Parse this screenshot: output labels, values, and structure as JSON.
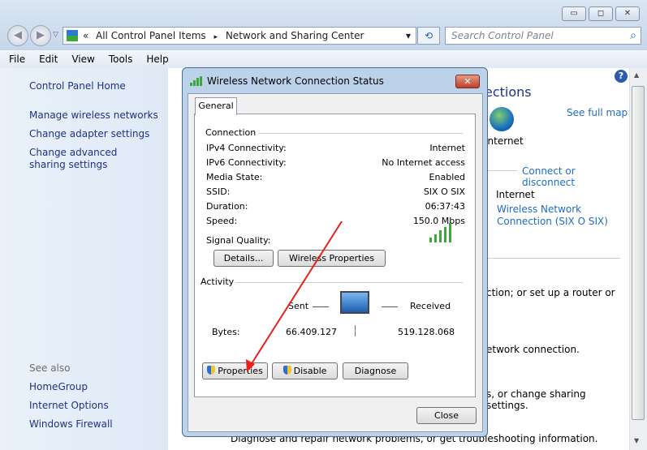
{
  "window": {
    "minimize": "▭",
    "maximize": "◻",
    "close": "✕"
  },
  "address": {
    "chevrons": "«",
    "crumb1": "All Control Panel Items",
    "sep": "▸",
    "crumb2": "Network and Sharing Center",
    "dropdown": "▾",
    "refresh": "⟲"
  },
  "search": {
    "placeholder": "Search Control Panel",
    "icon": "⌕"
  },
  "menu": [
    "File",
    "Edit",
    "View",
    "Tools",
    "Help"
  ],
  "sidebar": {
    "home": "Control Panel Home",
    "links": [
      "Manage wireless networks",
      "Change adapter settings",
      "Change advanced sharing settings"
    ],
    "see_also": "See also",
    "also_links": [
      "HomeGroup",
      "Internet Options",
      "Windows Firewall"
    ]
  },
  "main": {
    "heading_partial": "ections",
    "see_full_map": "See full map",
    "internet_label": "Internet",
    "connect_disconnect": "Connect or disconnect",
    "access_type": "Internet",
    "connection_link": "Wireless Network Connection (SIX O SIX)",
    "text1": "ction; or set up a router or",
    "text2": "etwork connection.",
    "text3": "s, or change sharing settings.",
    "text4": "Diagnose and repair network problems, or get troubleshooting information.",
    "help": "?"
  },
  "dialog": {
    "title": "Wireless Network Connection Status",
    "close": "✕",
    "tab": "General",
    "connection_group": "Connection",
    "rows": [
      {
        "label": "IPv4 Connectivity:",
        "value": "Internet"
      },
      {
        "label": "IPv6 Connectivity:",
        "value": "No Internet access"
      },
      {
        "label": "Media State:",
        "value": "Enabled"
      },
      {
        "label": "SSID:",
        "value": "SIX O SIX"
      },
      {
        "label": "Duration:",
        "value": "06:37:43"
      },
      {
        "label": "Speed:",
        "value": "150.0 Mbps"
      }
    ],
    "signal_label": "Signal Quality:",
    "signal_bars": 5,
    "details_btn": "Details...",
    "wireless_props_btn": "Wireless Properties",
    "activity_group": "Activity",
    "sent": "Sent",
    "received": "Received",
    "bytes_label": "Bytes:",
    "bytes_sent": "66.409.127",
    "bytes_received": "519.128.068",
    "properties_btn": "Properties",
    "disable_btn": "Disable",
    "diagnose_btn": "Diagnose",
    "close_btn": "Close"
  },
  "annotation": {
    "arrow_color": "#e8201c"
  }
}
